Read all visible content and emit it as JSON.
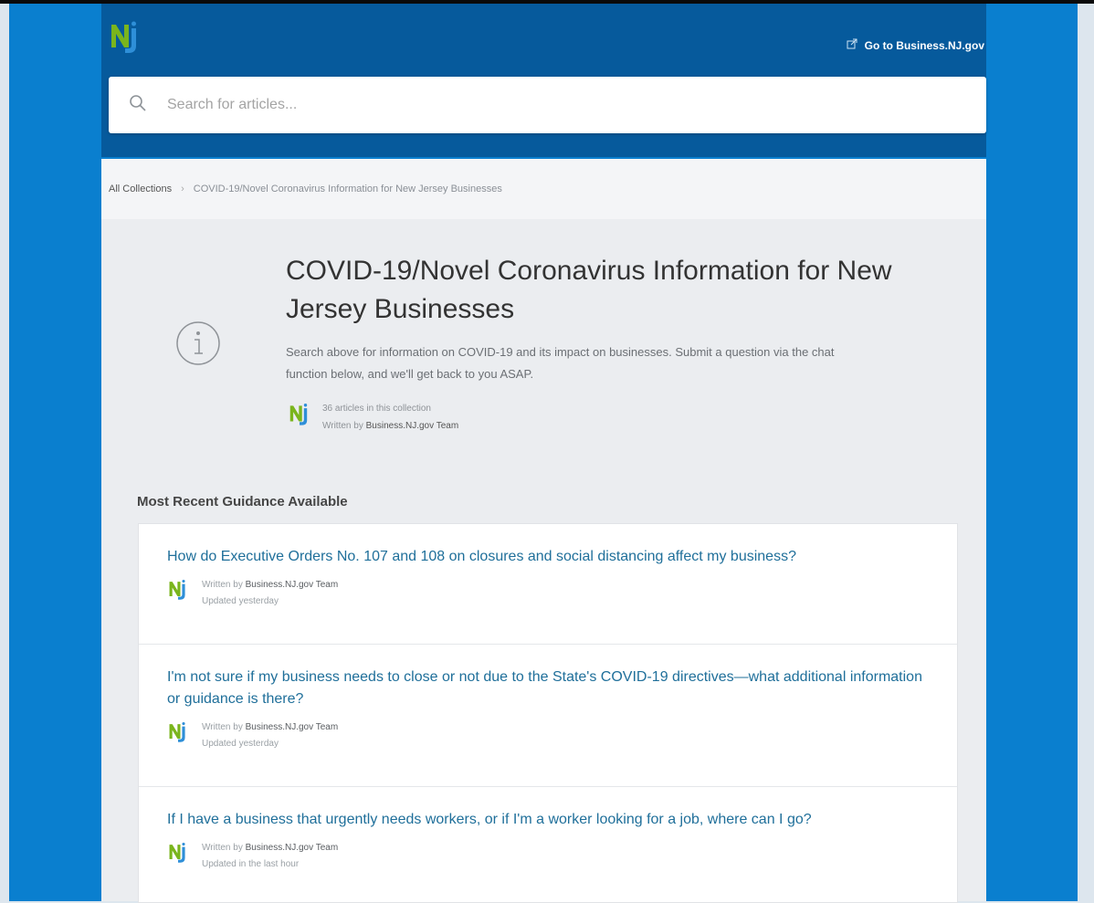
{
  "header": {
    "goto_label": "Go to Business.NJ.gov",
    "search_placeholder": "Search for articles..."
  },
  "breadcrumb": {
    "root": "All Collections",
    "current": "COVID-19/Novel Coronavirus Information for New Jersey Businesses"
  },
  "collection": {
    "title": "COVID-19/Novel Coronavirus Information for New Jersey Businesses",
    "description": "Search above for information on COVID-19 and its impact on businesses. Submit a question via the chat function below, and we'll get back to you ASAP.",
    "article_count": "36 articles in this collection",
    "written_by_prefix": "Written by",
    "author": "Business.NJ.gov Team"
  },
  "section": {
    "title": "Most Recent Guidance Available"
  },
  "articles": [
    {
      "title": "How do Executive Orders No. 107 and 108 on closures and social distancing affect my business?",
      "written_by_prefix": "Written by",
      "author": "Business.NJ.gov Team",
      "updated": "Updated yesterday"
    },
    {
      "title": "I'm not sure if my business needs to close or not due to the State's COVID-19 directives—what additional information or guidance is there?",
      "written_by_prefix": "Written by",
      "author": "Business.NJ.gov Team",
      "updated": "Updated yesterday"
    },
    {
      "title": "If I have a business that urgently needs workers, or if I'm a worker looking for a job, where can I go?",
      "written_by_prefix": "Written by",
      "author": "Business.NJ.gov Team",
      "updated": "Updated in the last hour"
    }
  ],
  "colors": {
    "outer_blue": "#0a7fcf",
    "header_blue": "#065a9c",
    "link_blue": "#1f6f9a",
    "nj_green": "#7ab51d"
  },
  "icons": {
    "logo": "nj-logo-icon",
    "external": "external-link-icon",
    "search": "search-icon",
    "info": "info-icon"
  }
}
